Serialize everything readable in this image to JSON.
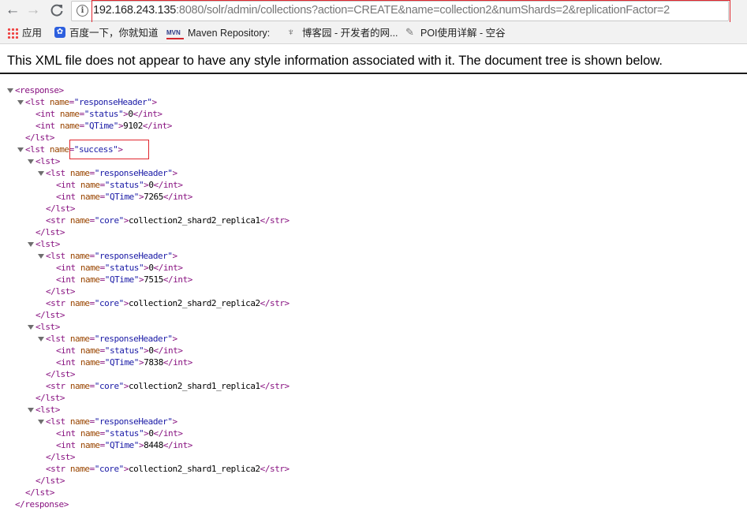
{
  "nav": {
    "back": "←",
    "forward": "→",
    "reload": "C"
  },
  "address_bar": {
    "host": "192.168.243.135",
    "rest": ":8080/solr/admin/collections?action=CREATE&name=collection2&numShards=2&replicationFactor=2"
  },
  "bookmarks": [
    {
      "label": "应用",
      "icon": "apps-grid-icon"
    },
    {
      "label": "百度一下，你就知道",
      "icon": "baidu-paw-icon"
    },
    {
      "label": "Maven Repository:",
      "icon": "maven-icon",
      "icon_text": "MVN"
    },
    {
      "label": "博客园 - 开发者的网...",
      "icon": "cnblogs-icon"
    },
    {
      "label": "POI使用详解 - 空谷",
      "icon": "page-icon"
    }
  ],
  "xml_notice": "This XML file does not appear to have any style information associated with it. The document tree is shown below.",
  "accent_color": "#e0262e",
  "xml": {
    "root_open": "<response>",
    "root_close": "</response>",
    "response_header": {
      "status": "0",
      "qtime": "9102"
    },
    "success_name": "success",
    "replicas": [
      {
        "status": "0",
        "qtime": "7265",
        "core": "collection2_shard2_replica1"
      },
      {
        "status": "0",
        "qtime": "7515",
        "core": "collection2_shard2_replica2"
      },
      {
        "status": "0",
        "qtime": "7838",
        "core": "collection2_shard1_replica1"
      },
      {
        "status": "0",
        "qtime": "8448",
        "core": "collection2_shard1_replica2"
      }
    ]
  }
}
